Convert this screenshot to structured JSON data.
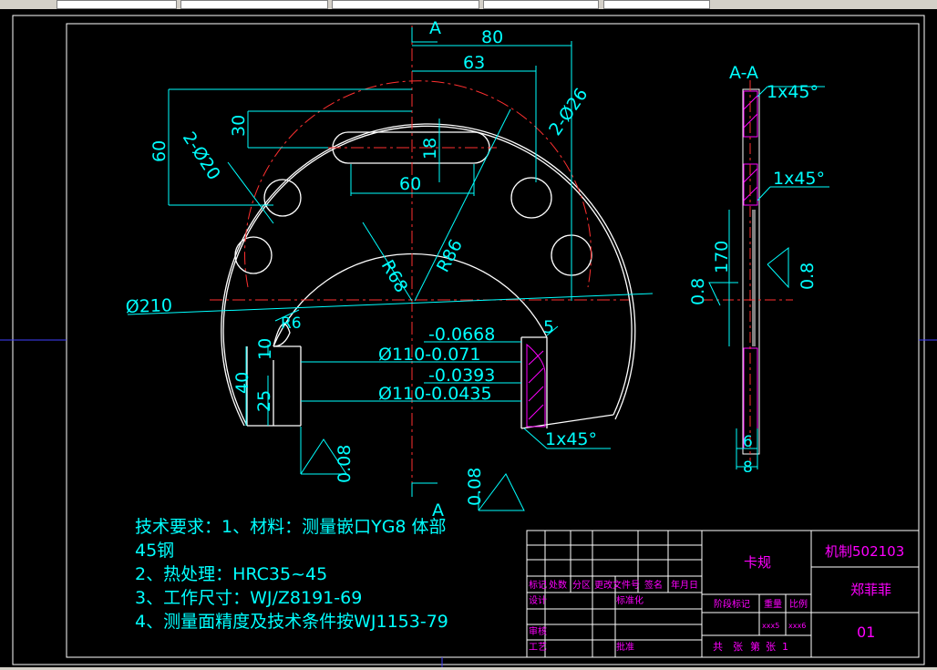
{
  "drawing": {
    "dimensions": {
      "d80": "80",
      "d63": "63",
      "d30": "30",
      "d60v": "60",
      "d18": "18",
      "d60h": "60",
      "hole26": "2-Ø26",
      "hole20": "2-Ø20",
      "r86": "R86",
      "r68": "R68",
      "r6": "R6",
      "d210": "Ø210",
      "tol1": "-0.0668",
      "tol2": "Ø110-0.071",
      "tol3": "-0.0393",
      "tol4": "Ø110-0.0435",
      "five": "5",
      "d10": "10",
      "d40": "40",
      "d25": "25",
      "chamfer": "1x45°",
      "rough08a": "0.08",
      "rough08b": "0.08",
      "sectionA_top": "A",
      "sectionA_bottom": "A"
    },
    "section": {
      "title": "A-A",
      "chamfer1": "1x45°",
      "chamfer2": "1x45°",
      "d170": "170",
      "rough_left": "0.8",
      "rough_right": "0.8",
      "d6": "6",
      "d8": "8"
    }
  },
  "notes": {
    "line1": "技术要求：1、材料：测量嵌口YG8  体部",
    "line2": "45钢",
    "line3": "2、热处理：HRC35~45",
    "line4": "3、工作尺寸：WJ/Z8191-69",
    "line5": "4、测量面精度及技术条件按WJ1153-79"
  },
  "title_block": {
    "part_name": "卡规",
    "drawing_no": "机制502103",
    "designer_name": "郑菲菲",
    "sheet": "01",
    "col_mark": "标记",
    "col_count": "处数",
    "col_zone": "分区",
    "col_docno": "更改文件号",
    "col_sign": "签名",
    "col_date": "年月日",
    "row_design": "设计",
    "row_std": "标准化",
    "row_check": "审核",
    "row_process": "工艺",
    "row_approve": "批准",
    "stage_mark": "阶段标记",
    "weight": "重量",
    "scale": "比例",
    "weight_val": "xxx5",
    "scale_val": "xxx6",
    "total": "共",
    "sheets_label": "张",
    "nth": "第",
    "sheet_of": "张",
    "sheet_num": "1"
  },
  "colors": {
    "background": "#000000",
    "dimension": "#00ffff",
    "outline": "#ffffff",
    "centerline": "#ff0000",
    "title_text": "#ff00ff",
    "hatch": "#ff00ff",
    "frame": "#0000ff"
  }
}
